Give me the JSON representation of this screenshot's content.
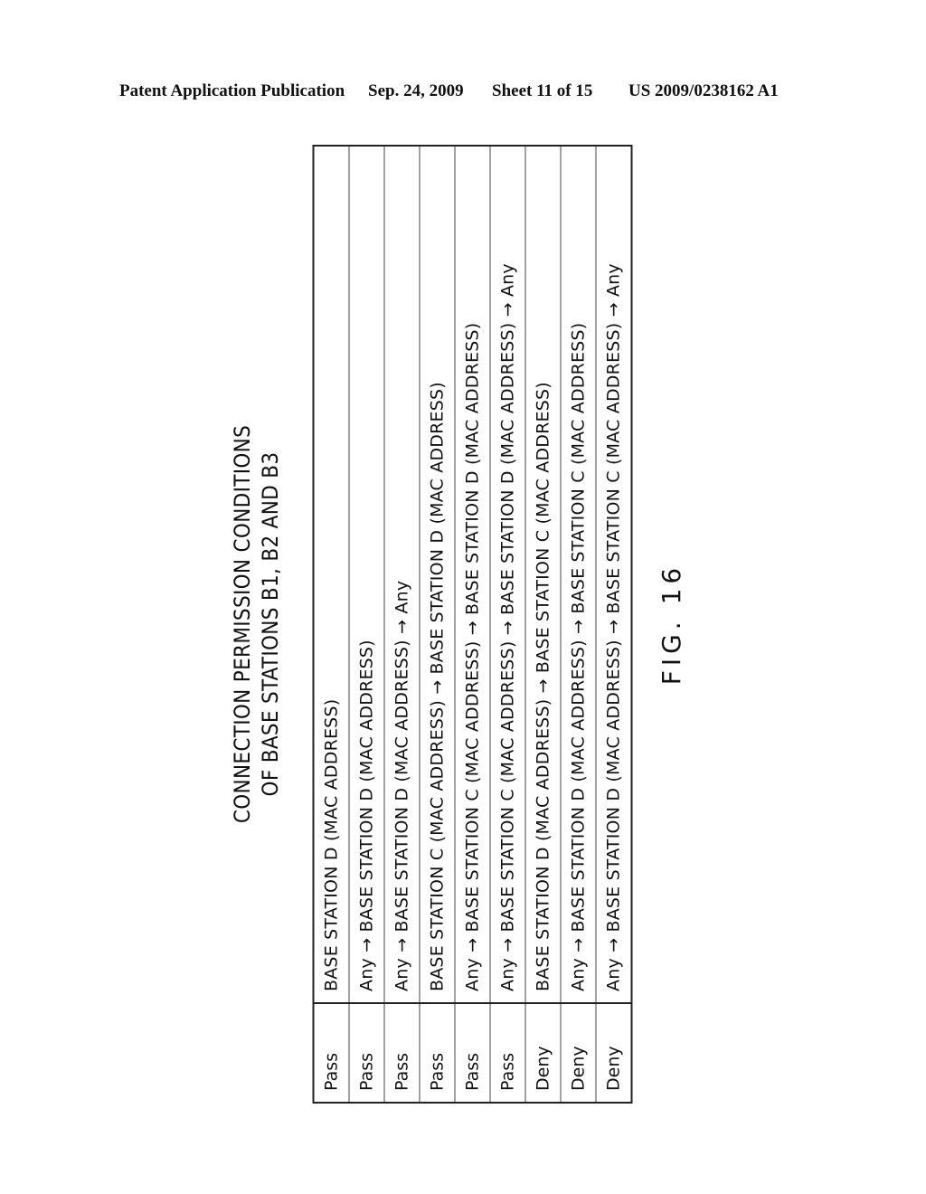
{
  "header": {
    "publication_type": "Patent Application Publication",
    "date": "Sep. 24, 2009",
    "sheet": "Sheet 11 of 15",
    "publication_number": "US 2009/0238162 A1"
  },
  "figure": {
    "title_line1": "CONNECTION PERMISSION CONDITIONS",
    "title_line2": "OF BASE STATIONS B1, B2 AND B3",
    "label": "FIG. 16"
  },
  "table": {
    "rows": [
      {
        "action": "Pass",
        "rule": "BASE STATION D (MAC ADDRESS)"
      },
      {
        "action": "Pass",
        "rule": "Any → BASE STATION D (MAC ADDRESS)"
      },
      {
        "action": "Pass",
        "rule": "Any → BASE STATION D (MAC ADDRESS) → Any"
      },
      {
        "action": "Pass",
        "rule": "BASE STATION C (MAC ADDRESS) → BASE STATION D (MAC ADDRESS)"
      },
      {
        "action": "Pass",
        "rule": "Any → BASE STATION C (MAC ADDRESS) → BASE STATION D (MAC ADDRESS)"
      },
      {
        "action": "Pass",
        "rule": "Any → BASE STATION C (MAC ADDRESS) → BASE STATION D (MAC ADDRESS) → Any"
      },
      {
        "action": "Deny",
        "rule": "BASE STATION D (MAC ADDRESS) → BASE STATION C (MAC ADDRESS)"
      },
      {
        "action": "Deny",
        "rule": "Any → BASE STATION D (MAC ADDRESS) → BASE STATION C (MAC ADDRESS)"
      },
      {
        "action": "Deny",
        "rule": "Any → BASE STATION D (MAC ADDRESS) → BASE STATION C (MAC ADDRESS) → Any"
      }
    ]
  }
}
